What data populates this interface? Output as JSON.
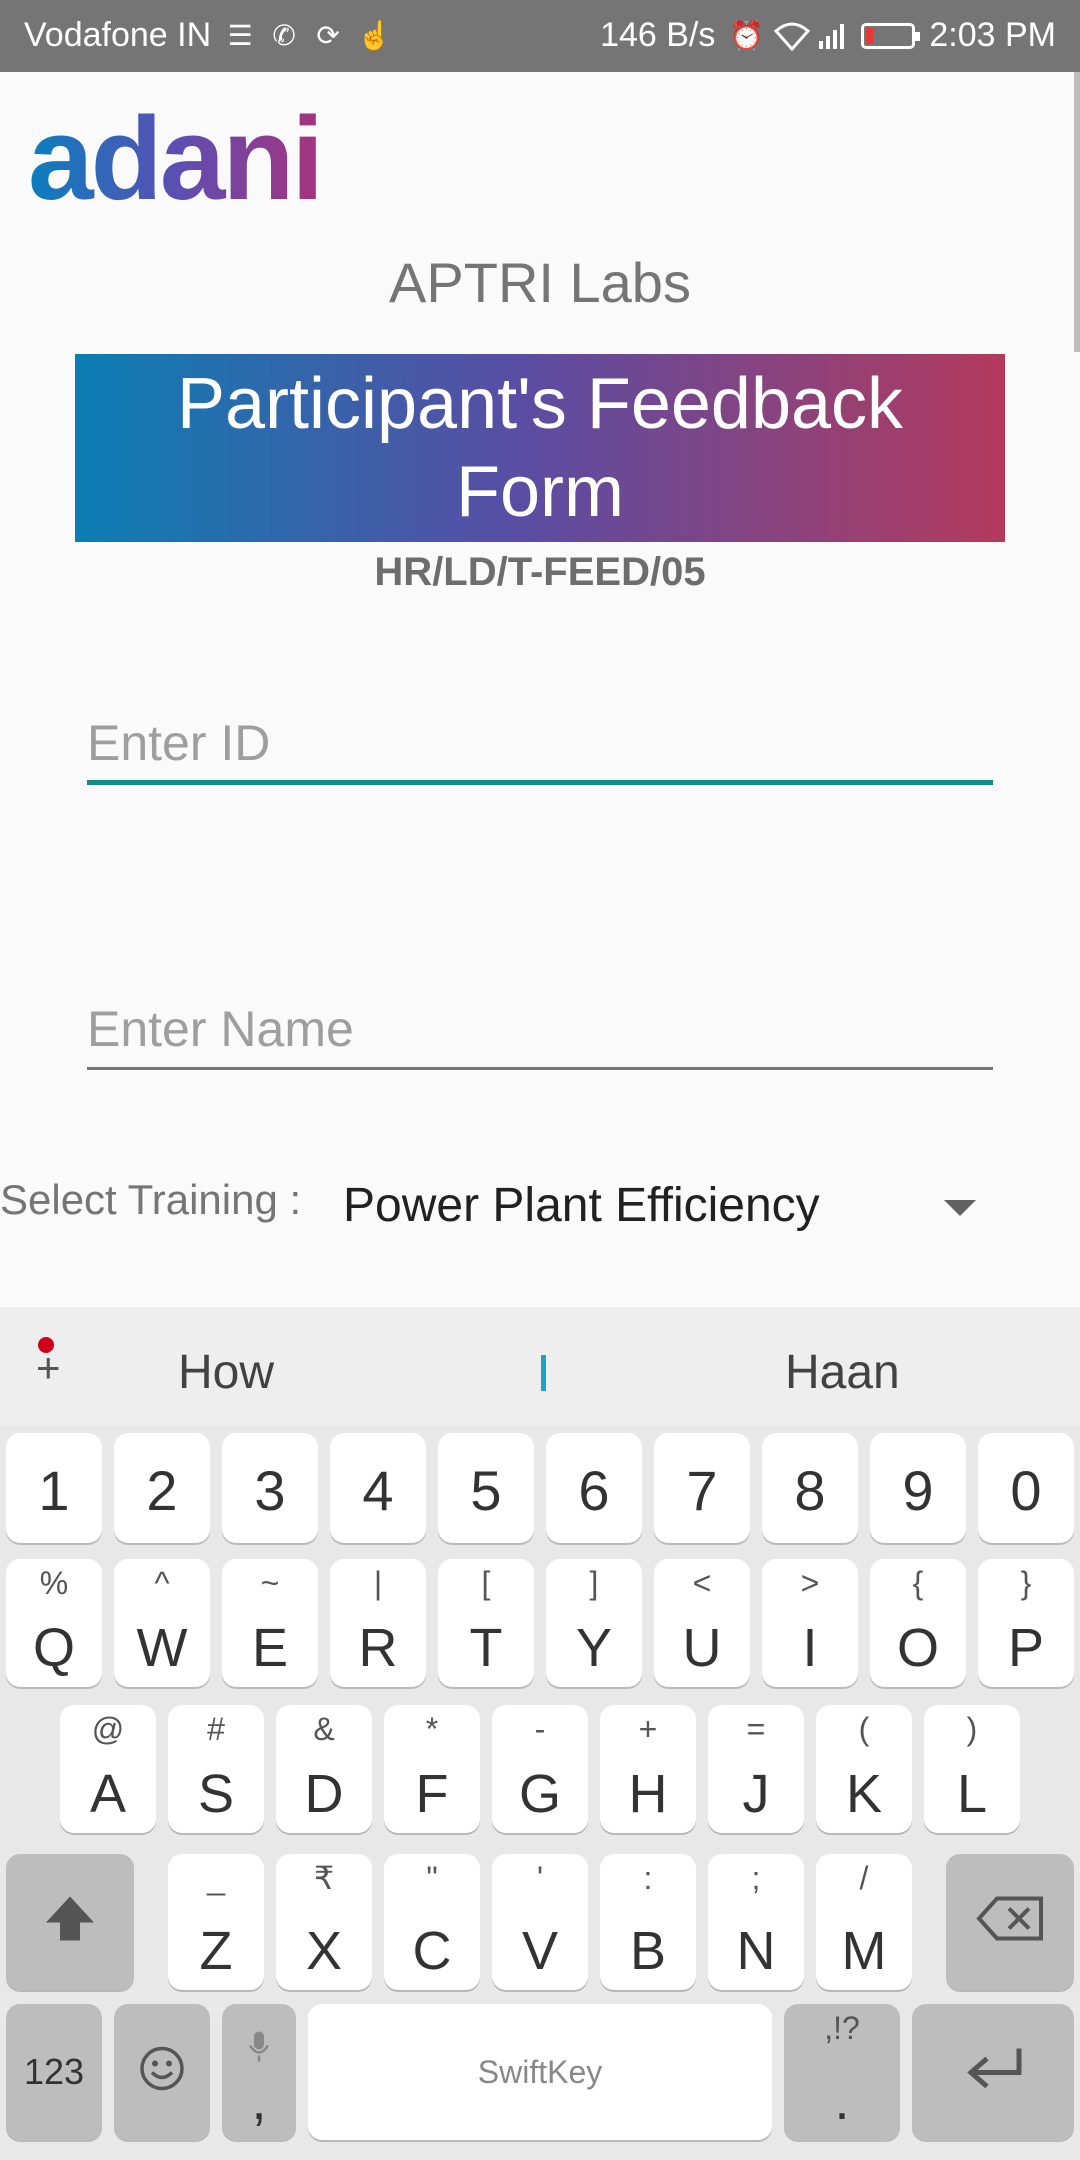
{
  "status_bar": {
    "carrier": "Vodafone IN",
    "speed": "146 B/s",
    "time": "2:03 PM",
    "icons": [
      "list-icon",
      "whatsapp-icon",
      "sync-icon",
      "touch-icon",
      "alarm-icon",
      "wifi-icon",
      "signal-icon",
      "battery-icon"
    ],
    "battery_level": 0.15,
    "battery_color": "#e53935"
  },
  "header": {
    "logo_text": "adani",
    "subtitle": "APTRI Labs",
    "banner_title": "Participant's Feedback Form",
    "form_code": "HR/LD/T-FEED/05"
  },
  "form": {
    "id_placeholder": "Enter ID",
    "name_placeholder": "Enter Name",
    "select_label": "Select Training :",
    "select_value": "Power Plant Efficiency"
  },
  "keyboard": {
    "suggestions": [
      "How",
      "Haan"
    ],
    "number_row": [
      "1",
      "2",
      "3",
      "4",
      "5",
      "6",
      "7",
      "8",
      "9",
      "0"
    ],
    "row1": [
      {
        "k": "Q",
        "s": "%"
      },
      {
        "k": "W",
        "s": "^"
      },
      {
        "k": "E",
        "s": "~"
      },
      {
        "k": "R",
        "s": "|"
      },
      {
        "k": "T",
        "s": "["
      },
      {
        "k": "Y",
        "s": "]"
      },
      {
        "k": "U",
        "s": "<"
      },
      {
        "k": "I",
        "s": ">"
      },
      {
        "k": "O",
        "s": "{"
      },
      {
        "k": "P",
        "s": "}"
      }
    ],
    "row2": [
      {
        "k": "A",
        "s": "@"
      },
      {
        "k": "S",
        "s": "#"
      },
      {
        "k": "D",
        "s": "&"
      },
      {
        "k": "F",
        "s": "*"
      },
      {
        "k": "G",
        "s": "-"
      },
      {
        "k": "H",
        "s": "+"
      },
      {
        "k": "J",
        "s": "="
      },
      {
        "k": "K",
        "s": "("
      },
      {
        "k": "L",
        "s": ")"
      }
    ],
    "row3": [
      {
        "k": "Z",
        "s": "_"
      },
      {
        "k": "X",
        "s": "₹"
      },
      {
        "k": "C",
        "s": "\""
      },
      {
        "k": "V",
        "s": "'"
      },
      {
        "k": "B",
        "s": ":"
      },
      {
        "k": "N",
        "s": ";"
      },
      {
        "k": "M",
        "s": "/"
      }
    ],
    "symbols_label": "123",
    "comma": ",",
    "period": ".",
    "period_hint": ",!?",
    "space_label": "SwiftKey",
    "icons": [
      "add-icon",
      "shift-icon",
      "backspace-icon",
      "emoji-icon",
      "mic-icon",
      "enter-icon"
    ]
  }
}
